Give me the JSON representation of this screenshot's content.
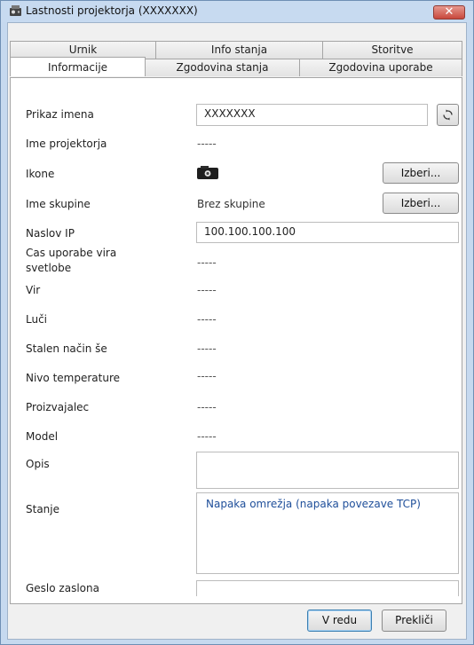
{
  "window": {
    "title": "Lastnosti projektorja (XXXXXXX)"
  },
  "icons": {
    "title": "projector-window-icon",
    "close": "close-x-icon",
    "refresh": "refresh-icon",
    "projector": "projector-icon"
  },
  "tabs": {
    "back": [
      "Urnik",
      "Info stanja",
      "Storitve"
    ],
    "front": [
      "Informacije",
      "Zgodovina stanja",
      "Zgodovina uporabe"
    ],
    "active": "Informacije"
  },
  "fields": {
    "display_name": {
      "label": "Prikaz imena",
      "value": "XXXXXXX"
    },
    "projector_name": {
      "label": "Ime projektorja",
      "value": "-----"
    },
    "icons": {
      "label": "Ikone",
      "button": "Izberi..."
    },
    "group_name": {
      "label": "Ime skupine",
      "value": "Brez skupine",
      "button": "Izberi..."
    },
    "ip_address": {
      "label": "Naslov IP",
      "value": "100.100.100.100"
    },
    "light_source_hours": {
      "label_line1": "Cas uporabe vira",
      "label_line2": "svetlobe",
      "value": "-----"
    },
    "source": {
      "label": "Vir",
      "value": "-----"
    },
    "lamps": {
      "label": "Luči",
      "value": "-----"
    },
    "constant_mode": {
      "label": "Stalen način še",
      "value": "-----"
    },
    "temperature_level": {
      "label": "Nivo temperature",
      "value": "-----"
    },
    "manufacturer": {
      "label": "Proizvajalec",
      "value": "-----"
    },
    "model": {
      "label": "Model",
      "value": "-----"
    },
    "description": {
      "label": "Opis",
      "value": ""
    },
    "status": {
      "label": "Stanje",
      "value": "Napaka omrežja (napaka povezave TCP)"
    },
    "screen_password": {
      "label": "Geslo zaslona",
      "value": ""
    }
  },
  "buttons": {
    "ok": "V redu",
    "cancel": "Prekliči"
  },
  "colors": {
    "status_text": "#1f4f9a",
    "titlebar": "#c7daf0",
    "close_button": "#c8483c"
  }
}
